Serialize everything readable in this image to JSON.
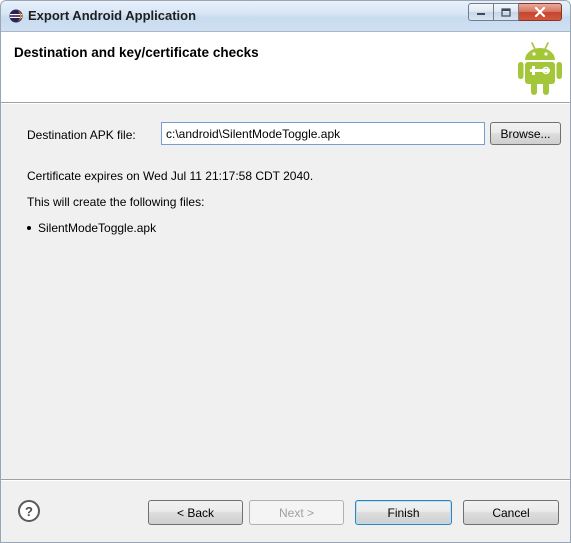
{
  "window": {
    "title": "Export Android Application",
    "controls": {
      "minimize_icon": "minimize-icon",
      "maximize_icon": "maximize-icon",
      "close_icon": "close-icon",
      "close_glyph": "x"
    }
  },
  "header": {
    "title": "Destination and key/certificate checks",
    "logo_icon": "android-robot-icon"
  },
  "form": {
    "destination_label": "Destination APK file:",
    "destination_value": "c:\\android\\SilentModeToggle.apk",
    "browse_label": "Browse..."
  },
  "info": {
    "certificate_expiry": "Certificate expires on Wed Jul 11 21:17:58 CDT 2040.",
    "files_intro": "This will create the following files:",
    "files": [
      "SilentModeToggle.apk"
    ]
  },
  "footer": {
    "help_icon": "help-icon",
    "help_glyph": "?",
    "back_label": "< Back",
    "next_label": "Next >",
    "finish_label": "Finish",
    "cancel_label": "Cancel"
  },
  "colors": {
    "android_green": "#a4c639",
    "close_red": "#c5452d",
    "dialog_bg": "#f0f0f0"
  }
}
